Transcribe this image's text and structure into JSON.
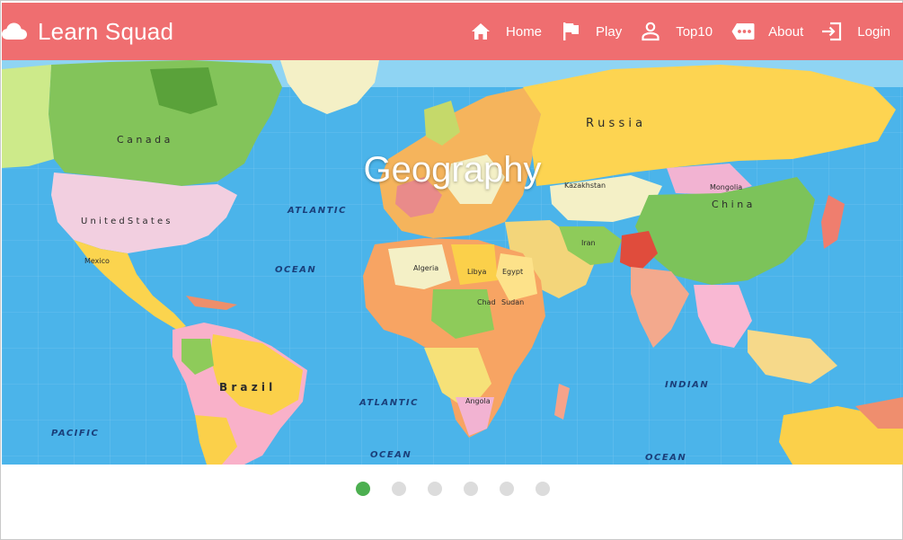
{
  "app": {
    "title": "Learn Squad",
    "brand_color": "#ef6e70",
    "logo_icon": "cloud-icon"
  },
  "nav": {
    "items": [
      {
        "label": "Home",
        "icon": "home-icon"
      },
      {
        "label": "Play",
        "icon": "flag-icon"
      },
      {
        "label": "Top10",
        "icon": "person-icon"
      },
      {
        "label": "About",
        "icon": "chat-bubble-icon"
      },
      {
        "label": "Login",
        "icon": "login-icon"
      }
    ]
  },
  "carousel": {
    "slide_title": "Geography",
    "slide_image": "world political map",
    "map_labels": {
      "canada": "C a n a d a",
      "us": "U n i t e d  S t a t e s",
      "mexico": "Mexico",
      "brazil": "B r a z i l",
      "russia": "R u s s i a",
      "china": "C h i n a",
      "kazakhstan": "Kazakhstan",
      "mongolia": "Mongolia",
      "iran": "Iran",
      "libya": "Libya",
      "egypt": "Egypt",
      "chad": "Chad",
      "sudan": "Sudan",
      "angola": "Angola",
      "algeria": "Algeria",
      "atlantic_north": "ATLANTIC",
      "atlantic_south": "ATLANTIC",
      "ocean_north": "OCEAN",
      "ocean_south": "OCEAN",
      "pacific": "PACIFIC",
      "indian": "INDIAN",
      "ocean_east": "OCEAN"
    },
    "dots_count": 6,
    "active_index": 0,
    "dot_active_color": "#4caf50",
    "dot_inactive_color": "#dcdcdc"
  }
}
